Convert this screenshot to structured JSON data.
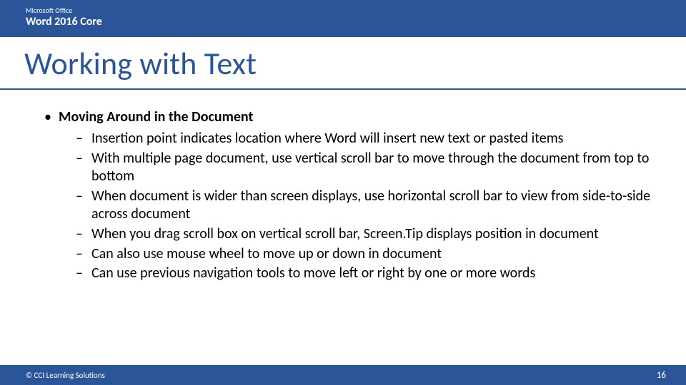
{
  "colors": {
    "brand": "#2a5699"
  },
  "header": {
    "superTitle": "Microsoft Office",
    "course": "Word 2016 Core"
  },
  "title": "Working with Text",
  "content": {
    "heading": "Moving Around in the Document",
    "items": [
      "Insertion point indicates location where Word will insert new text or pasted items",
      "With multiple page document, use vertical scroll bar to move through the document from top to bottom",
      "When document is wider than screen displays, use horizontal scroll bar to view from side-to-side across document",
      "When you drag scroll box on vertical scroll bar, Screen.Tip displays position in document",
      "Can also use mouse wheel to move up or down in document",
      "Can use previous navigation tools to move left or right by one or more words"
    ]
  },
  "footer": {
    "copyright": "© CCI Learning Solutions",
    "page": "16"
  }
}
